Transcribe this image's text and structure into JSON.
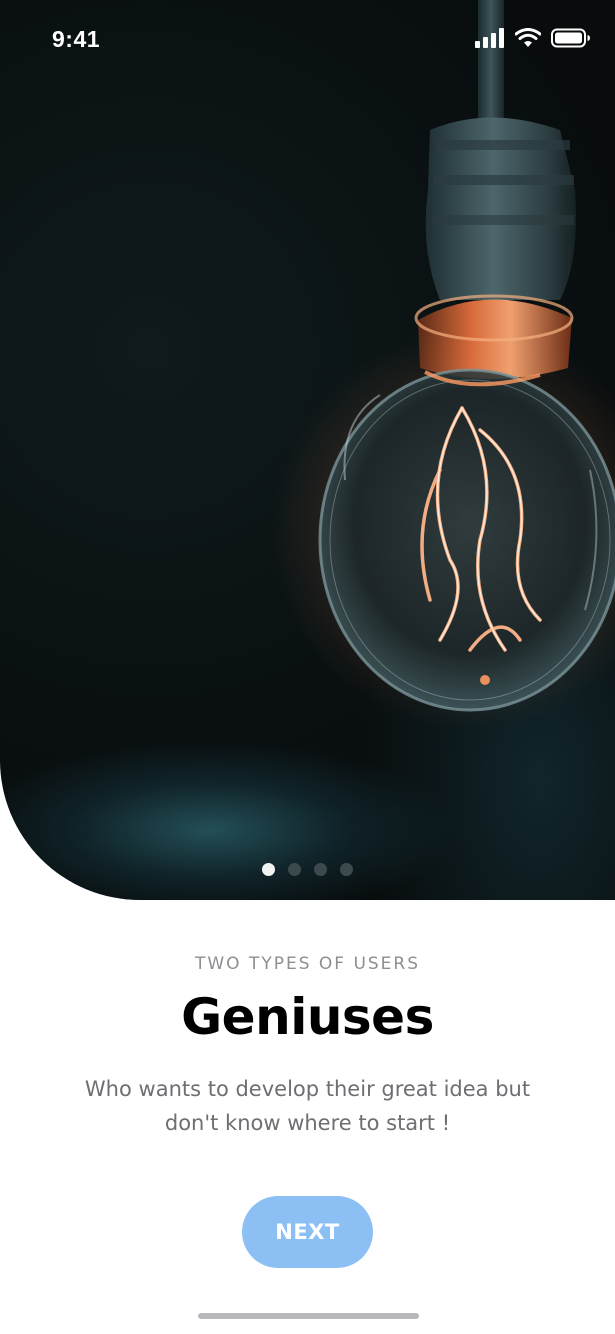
{
  "status_bar": {
    "time": "9:41",
    "signal_icon": "cellular-signal-icon",
    "wifi_icon": "wifi-icon",
    "battery_icon": "battery-icon"
  },
  "hero": {
    "image": "lightbulb-photo"
  },
  "pagination": {
    "total": 4,
    "active_index": 0
  },
  "content": {
    "eyebrow": "TWO TYPES OF USERS",
    "title": "Geniuses",
    "description": "Who wants to develop their great idea but don't know where to start !"
  },
  "actions": {
    "next_label": "NEXT",
    "next_color": "#8cc0f5"
  }
}
